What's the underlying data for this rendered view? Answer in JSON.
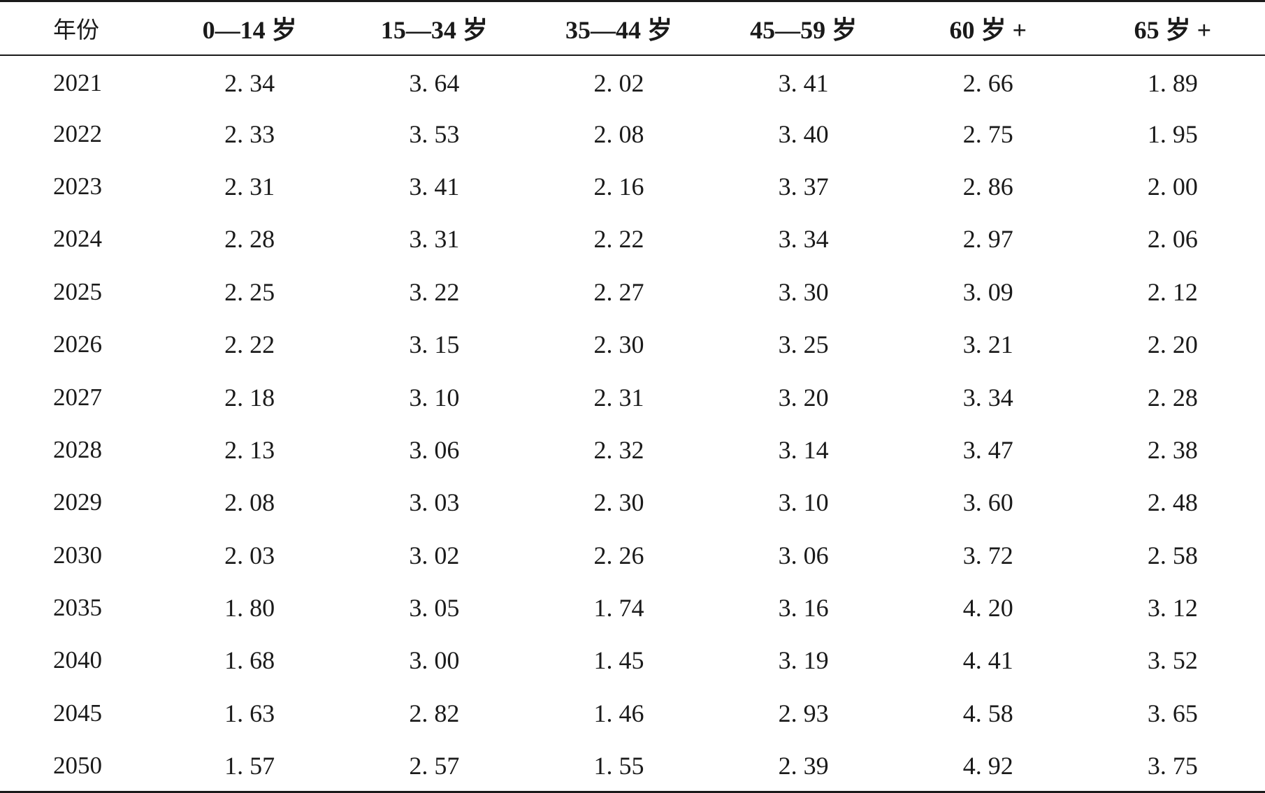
{
  "table": {
    "headers": [
      "年份",
      "0—14 岁",
      "15—34 岁",
      "35—44 岁",
      "45—59 岁",
      "60 岁 +",
      "65 岁 +"
    ],
    "rows": [
      [
        "2021",
        "2. 34",
        "3. 64",
        "2. 02",
        "3. 41",
        "2. 66",
        "1. 89"
      ],
      [
        "2022",
        "2. 33",
        "3. 53",
        "2. 08",
        "3. 40",
        "2. 75",
        "1. 95"
      ],
      [
        "2023",
        "2. 31",
        "3. 41",
        "2. 16",
        "3. 37",
        "2. 86",
        "2. 00"
      ],
      [
        "2024",
        "2. 28",
        "3. 31",
        "2. 22",
        "3. 34",
        "2. 97",
        "2. 06"
      ],
      [
        "2025",
        "2. 25",
        "3. 22",
        "2. 27",
        "3. 30",
        "3. 09",
        "2. 12"
      ],
      [
        "2026",
        "2. 22",
        "3. 15",
        "2. 30",
        "3. 25",
        "3. 21",
        "2. 20"
      ],
      [
        "2027",
        "2. 18",
        "3. 10",
        "2. 31",
        "3. 20",
        "3. 34",
        "2. 28"
      ],
      [
        "2028",
        "2. 13",
        "3. 06",
        "2. 32",
        "3. 14",
        "3. 47",
        "2. 38"
      ],
      [
        "2029",
        "2. 08",
        "3. 03",
        "2. 30",
        "3. 10",
        "3. 60",
        "2. 48"
      ],
      [
        "2030",
        "2. 03",
        "3. 02",
        "2. 26",
        "3. 06",
        "3. 72",
        "2. 58"
      ],
      [
        "2035",
        "1. 80",
        "3. 05",
        "1. 74",
        "3. 16",
        "4. 20",
        "3. 12"
      ],
      [
        "2040",
        "1. 68",
        "3. 00",
        "1. 45",
        "3. 19",
        "4. 41",
        "3. 52"
      ],
      [
        "2045",
        "1. 63",
        "2. 82",
        "1. 46",
        "2. 93",
        "4. 58",
        "3. 65"
      ],
      [
        "2050",
        "1. 57",
        "2. 57",
        "1. 55",
        "2. 39",
        "4. 92",
        "3. 75"
      ]
    ]
  },
  "chart_data": {
    "type": "table",
    "columns": [
      "年份",
      "0—14 岁",
      "15—34 岁",
      "35—44 岁",
      "45—59 岁",
      "60 岁 +",
      "65 岁 +"
    ],
    "x": [
      2021,
      2022,
      2023,
      2024,
      2025,
      2026,
      2027,
      2028,
      2029,
      2030,
      2035,
      2040,
      2045,
      2050
    ],
    "series": [
      {
        "name": "0—14 岁",
        "values": [
          2.34,
          2.33,
          2.31,
          2.28,
          2.25,
          2.22,
          2.18,
          2.13,
          2.08,
          2.03,
          1.8,
          1.68,
          1.63,
          1.57
        ]
      },
      {
        "name": "15—34 岁",
        "values": [
          3.64,
          3.53,
          3.41,
          3.31,
          3.22,
          3.15,
          3.1,
          3.06,
          3.03,
          3.02,
          3.05,
          3.0,
          2.82,
          2.57
        ]
      },
      {
        "name": "35—44 岁",
        "values": [
          2.02,
          2.08,
          2.16,
          2.22,
          2.27,
          2.3,
          2.31,
          2.32,
          2.3,
          2.26,
          1.74,
          1.45,
          1.46,
          1.55
        ]
      },
      {
        "name": "45—59 岁",
        "values": [
          3.41,
          3.4,
          3.37,
          3.34,
          3.3,
          3.25,
          3.2,
          3.14,
          3.1,
          3.06,
          3.16,
          3.19,
          2.93,
          2.39
        ]
      },
      {
        "name": "60 岁 +",
        "values": [
          2.66,
          2.75,
          2.86,
          2.97,
          3.09,
          3.21,
          3.34,
          3.47,
          3.6,
          3.72,
          4.2,
          4.41,
          4.58,
          4.92
        ]
      },
      {
        "name": "65 岁 +",
        "values": [
          1.89,
          1.95,
          2.0,
          2.06,
          2.12,
          2.2,
          2.28,
          2.38,
          2.48,
          2.58,
          3.12,
          3.52,
          3.65,
          3.75
        ]
      }
    ]
  }
}
